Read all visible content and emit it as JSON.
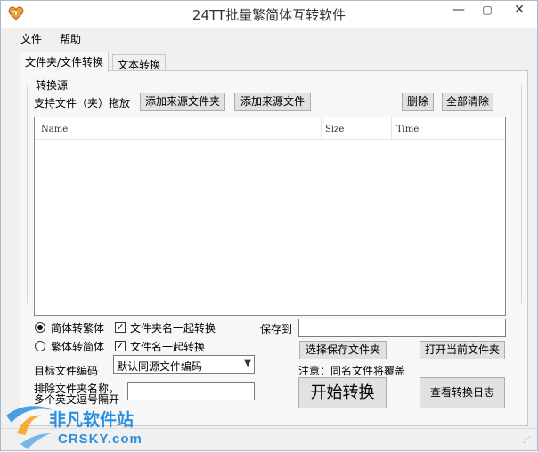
{
  "window": {
    "title": "24TT批量繁简体互转软件",
    "minimize": "—",
    "maximize": "▢",
    "close": "✕"
  },
  "menu": [
    "文件",
    "帮助"
  ],
  "tabs": [
    "文件夹/文件转换",
    "文本转换"
  ],
  "source": {
    "group_label": "转换源",
    "drag_hint": "支持文件（夹）拖放",
    "add_folder": "添加来源文件夹",
    "add_file": "添加来源文件",
    "delete": "删除",
    "clear_all": "全部清除"
  },
  "list": {
    "columns": [
      "Name",
      "Size",
      "Time"
    ],
    "rows": []
  },
  "options": {
    "to_traditional": "简体转繁体",
    "to_simplified": "繁体转简体",
    "folder_names": "文件夹名一起转换",
    "file_names": "文件名一起转换",
    "target_encoding_label": "目标文件编码",
    "target_encoding_value": "默认同源文件编码",
    "exclude_label_1": "排除文件夹名称，",
    "exclude_label_2": "多个英文逗号隔开",
    "exclude_value": ""
  },
  "save": {
    "label": "保存到",
    "path": "",
    "choose_folder": "选择保存文件夹",
    "open_folder": "打开当前文件夹",
    "note": "注意：同名文件将覆盖"
  },
  "actions": {
    "start": "开始转换",
    "view_log": "查看转换日志"
  },
  "watermark": {
    "name": "非凡软件站",
    "domain": "CRSKY.com"
  },
  "colors": {
    "accent": "#1e7fd6",
    "watermark_blue": "#2a8fe0"
  }
}
